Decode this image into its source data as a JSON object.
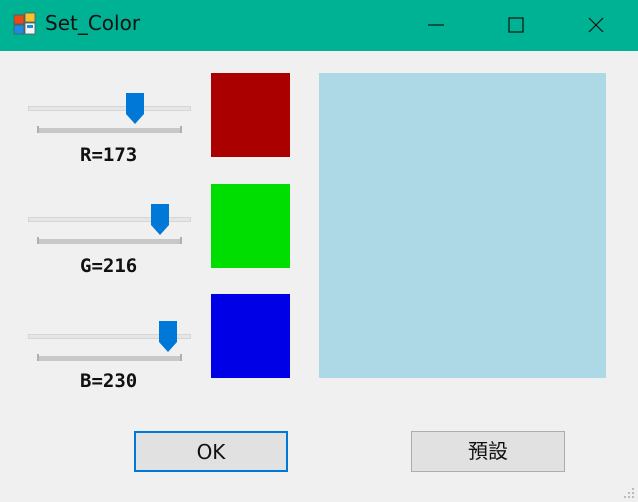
{
  "window": {
    "title": "Set_Color"
  },
  "colors": {
    "titlebar": "#00b294",
    "accent": "#0078d7"
  },
  "sliders": [
    {
      "label": "R=173",
      "value": 173,
      "max": 255,
      "swatch_color": "#aa0000"
    },
    {
      "label": "G=216",
      "value": 216,
      "max": 255,
      "swatch_color": "#00dd00"
    },
    {
      "label": "B=230",
      "value": 230,
      "max": 255,
      "swatch_color": "#0000e6"
    }
  ],
  "preview_color": "#add8e6",
  "buttons": {
    "ok": "OK",
    "reset": "預設"
  }
}
